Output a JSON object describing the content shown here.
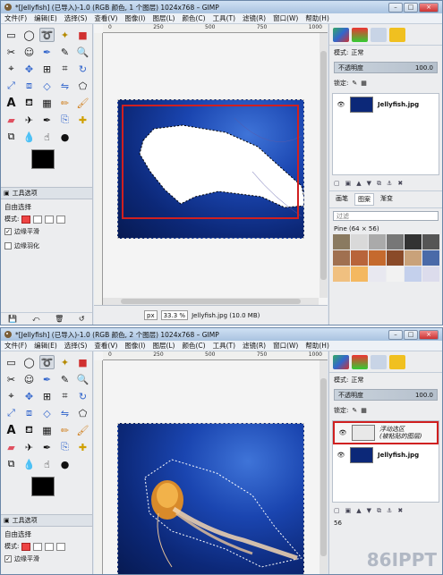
{
  "window1": {
    "title": "*[Jellyfish] (已导入)-1.0 (RGB 颜色, 1 个图层) 1024x768 – GIMP",
    "status_unit": "px",
    "status_zoom": "33.3 %",
    "status_info": "Jellyfish.jpg (10.0 MB)",
    "layers": [
      {
        "name": "Jellyfish.jpg"
      }
    ],
    "brushes_filter_placeholder": "过滤",
    "pattern_label": "Pine (64 × 56)"
  },
  "window2": {
    "title": "*[Jellyfish] (已导入)-1.0 (RGB 颜色, 2 个图层) 1024x768 – GIMP",
    "layers": [
      {
        "name": "浮动选区",
        "name2": "(被粘贴的图层)"
      },
      {
        "name": "Jellyfish.jpg"
      }
    ],
    "pattern_label_partial": "56"
  },
  "menu": [
    "文件(F)",
    "编辑(E)",
    "选择(S)",
    "查看(V)",
    "图像(I)",
    "图层(L)",
    "颜色(C)",
    "工具(T)",
    "滤镜(R)",
    "窗口(W)",
    "帮助(H)"
  ],
  "window_buttons": [
    "–",
    "□",
    "×"
  ],
  "ruler_marks": [
    "0",
    "250",
    "500",
    "750",
    "1000"
  ],
  "tool_options": {
    "tab_label": "工具选项",
    "title": "自由选择",
    "mode_label": "模式:",
    "antialias_label": "边缘平滑",
    "feather_label": "边缘羽化"
  },
  "layers_panel": {
    "mode_label": "模式:",
    "mode_value": "正常",
    "opacity_label": "不透明度",
    "opacity_value": "100.0",
    "lock_label": "锁定:"
  },
  "lower_tabs": [
    "画笔",
    "图案",
    "渐变"
  ],
  "watermark": "86IPPT",
  "colors": {
    "selection_highlight": "#d02020",
    "canvas_bg": "#0c2878"
  }
}
